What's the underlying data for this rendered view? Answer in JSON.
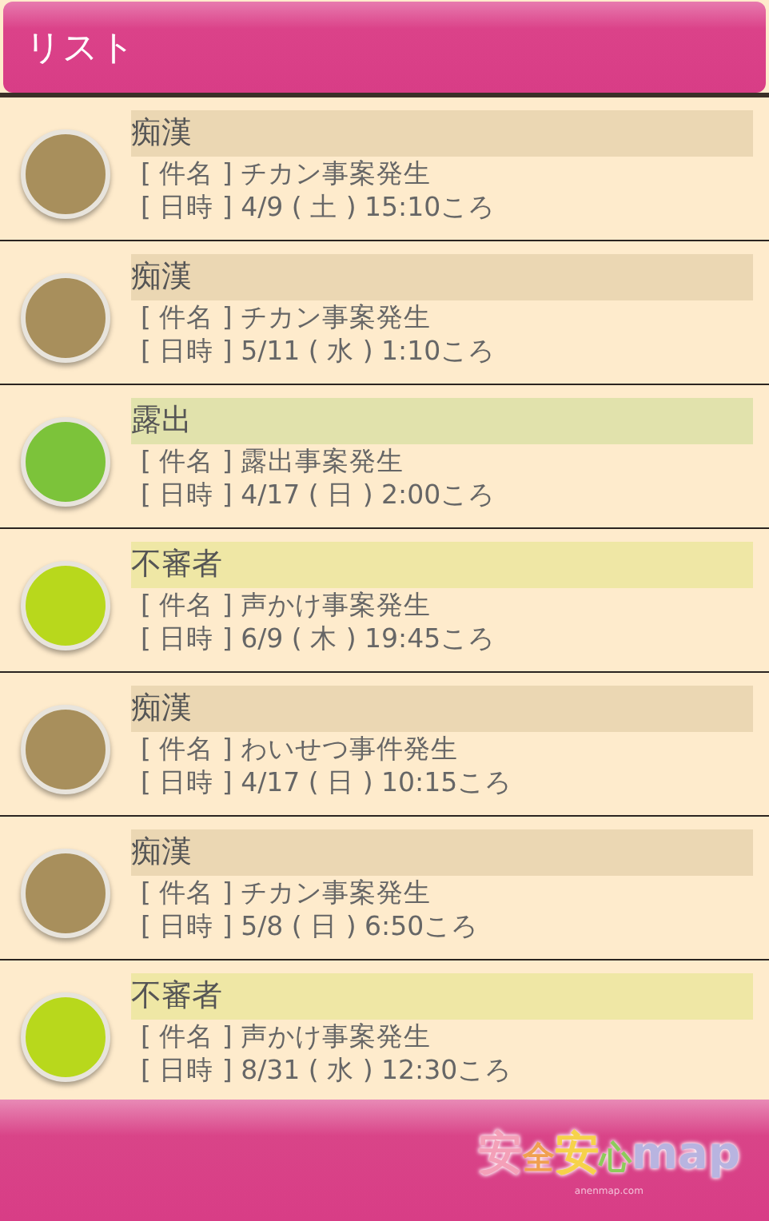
{
  "header": {
    "title": "リスト"
  },
  "items": [
    {
      "category": "痴漢",
      "color": "#a88f5c",
      "subject": "[ 件名 ] チカン事案発生",
      "datetime": "[ 日時 ] 4/9 ( 土 ) 15:10ころ"
    },
    {
      "category": "痴漢",
      "color": "#a88f5c",
      "subject": "[ 件名 ] チカン事案発生",
      "datetime": "[ 日時 ] 5/11 ( 水 ) 1:10ころ"
    },
    {
      "category": "露出",
      "color": "#7cc33a",
      "subject": "[ 件名 ] 露出事案発生",
      "datetime": "[ 日時 ] 4/17 ( 日 ) 2:00ころ"
    },
    {
      "category": "不審者",
      "color": "#b8d81c",
      "subject": "[ 件名 ] 声かけ事案発生",
      "datetime": "[ 日時 ] 6/9 ( 木 ) 19:45ころ"
    },
    {
      "category": "痴漢",
      "color": "#a88f5c",
      "subject": "[ 件名 ] わいせつ事件発生",
      "datetime": "[ 日時 ] 4/17 ( 日 ) 10:15ころ"
    },
    {
      "category": "痴漢",
      "color": "#a88f5c",
      "subject": "[ 件名 ] チカン事案発生",
      "datetime": "[ 日時 ] 5/8 ( 日 ) 6:50ころ"
    },
    {
      "category": "不審者",
      "color": "#b8d81c",
      "subject": "[ 件名 ] 声かけ事案発生",
      "datetime": "[ 日時 ] 8/31 ( 水 ) 12:30ころ"
    }
  ],
  "footer": {
    "logo": [
      {
        "text": "安",
        "color": "#f4a0b8"
      },
      {
        "text": "全",
        "color": "#f0a050"
      },
      {
        "text": "安",
        "color": "#f6d24a"
      },
      {
        "text": "心",
        "color": "#8ccc5a"
      },
      {
        "text": "map",
        "color": "#b8b4e0"
      }
    ],
    "domain": "anenmap.com"
  }
}
